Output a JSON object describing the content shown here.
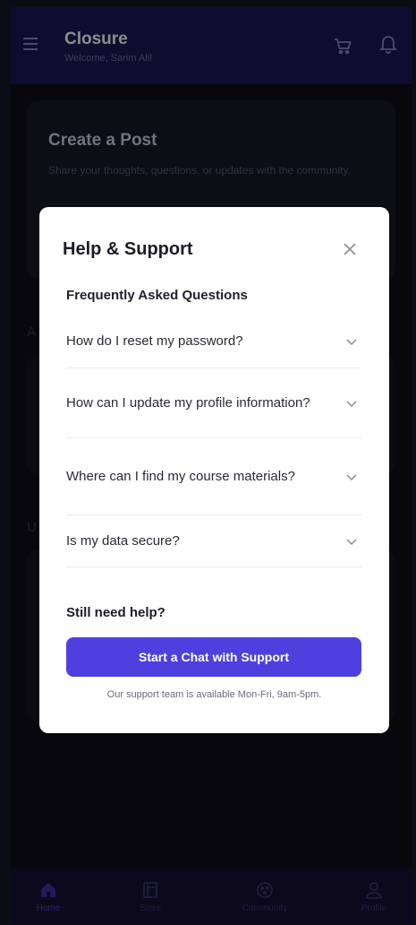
{
  "header": {
    "title": "Closure",
    "subtitle": "Welcome, Sarim Ali!",
    "icons": [
      "menu-icon",
      "cart-icon",
      "bell-icon"
    ]
  },
  "background": {
    "create_post_title": "Create a Post",
    "create_post_subtitle": "Share your thoughts, questions, or updates with the community.",
    "section_letter_1": "A",
    "section_letter_2": "U"
  },
  "modal": {
    "title": "Help & Support",
    "faq_heading": "Frequently Asked Questions",
    "faqs": [
      {
        "question": "How do I reset my password?"
      },
      {
        "question": "How can I update my profile information?"
      },
      {
        "question": "Where can I find my course materials?"
      },
      {
        "question": "Is my data secure?"
      }
    ],
    "help_heading": "Still need help?",
    "chat_button_label": "Start a Chat with Support",
    "availability_text": "Our support team is available Mon-Fri, 9am-5pm."
  },
  "bottom_nav": {
    "items": [
      {
        "label": "Home",
        "icon": "home-icon",
        "active": true
      },
      {
        "label": "Store",
        "icon": "store-icon",
        "active": false
      },
      {
        "label": "Community",
        "icon": "community-icon",
        "active": false
      },
      {
        "label": "Profile",
        "icon": "profile-icon",
        "active": false
      }
    ]
  },
  "colors": {
    "header_bg": "#1d1856",
    "accent": "#4d40de",
    "page_bg": "#0d0d16",
    "modal_bg": "#ffffff"
  }
}
